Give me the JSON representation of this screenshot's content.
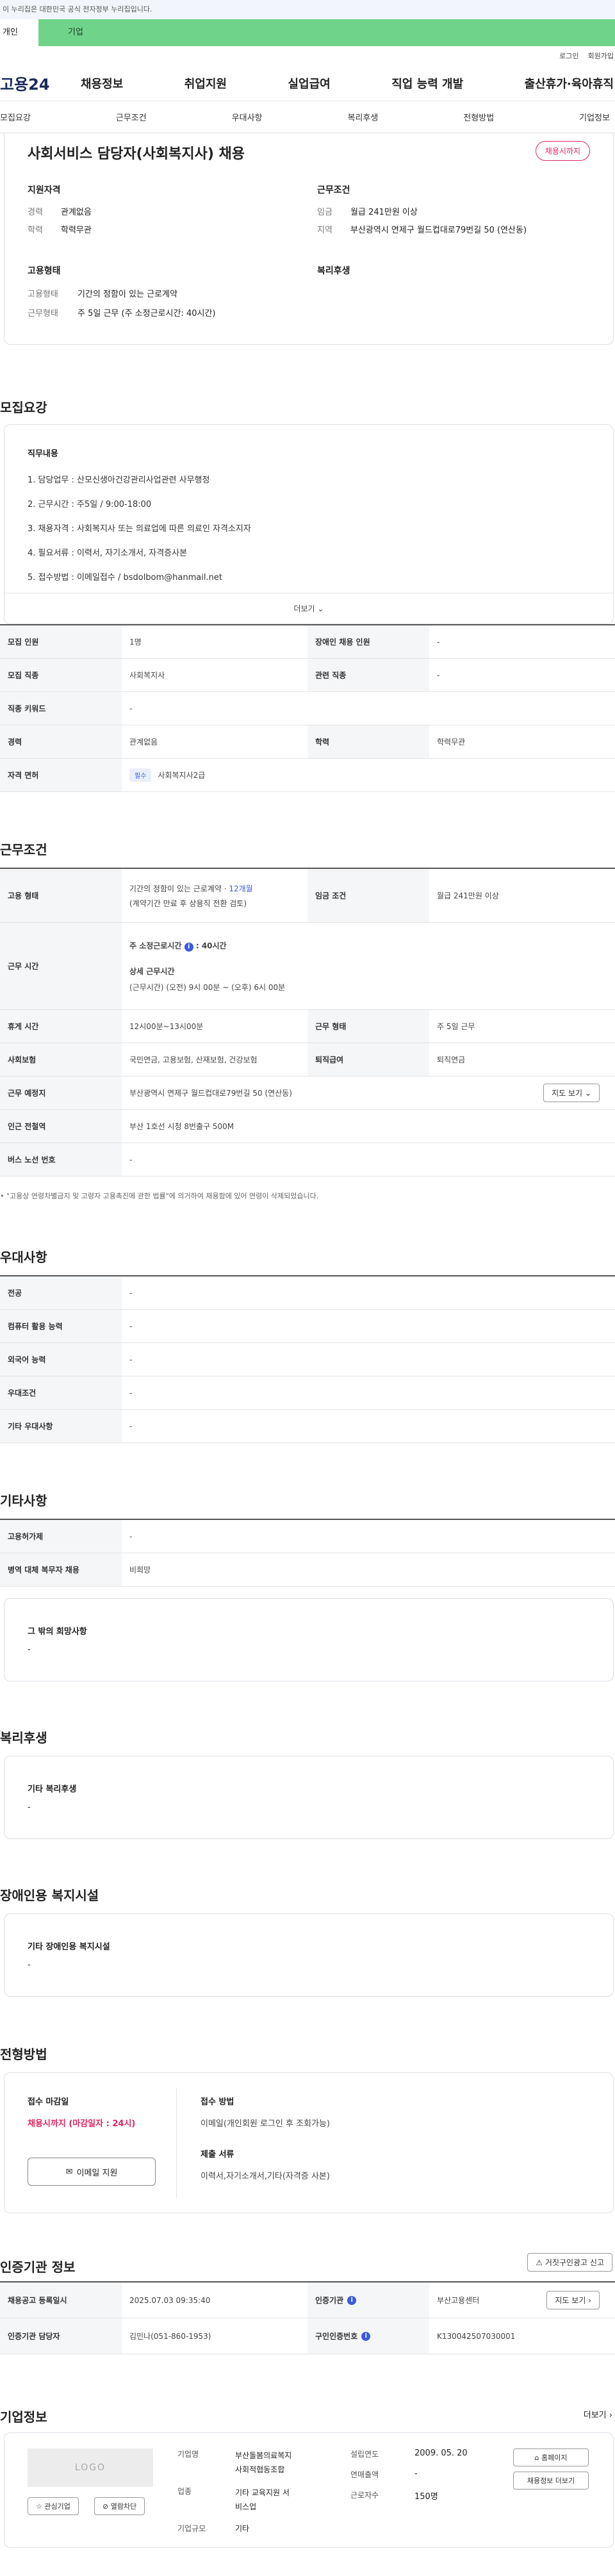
{
  "gov_banner": "이 누리집은 대한민국 공식 전자정부 누리집입니다.",
  "top_tabs": [
    "개인",
    "기업"
  ],
  "util_links": [
    "로그인",
    "회원가입"
  ],
  "gnb": {
    "logo": "고용24",
    "menu": [
      "채용정보",
      "취업지원",
      "실업급여",
      "직업 능력 개발",
      "출산휴가·육아휴직"
    ]
  },
  "snb": [
    "모집요강",
    "근무조건",
    "우대사항",
    "복리후생",
    "전형방법",
    "기업정보"
  ],
  "summary": {
    "title": "사회서비스 담당자(사회복지사) 채용",
    "badge": "채용시까지",
    "qual_head": "지원자격",
    "qual": [
      {
        "k": "경력",
        "v": "관계없음"
      },
      {
        "k": "학력",
        "v": "학력무관"
      }
    ],
    "cond_head": "근무조건",
    "cond": [
      {
        "k": "임금",
        "v": "월급 241만원 이상"
      },
      {
        "k": "지역",
        "v": "부산광역시 연제구 월드컵대로79번길 50 (연산동)"
      }
    ],
    "emp_head": "고용형태",
    "emp": [
      {
        "k": "고용형태",
        "v": "기간의 정함이 있는 근로계약"
      },
      {
        "k": "근무형태",
        "v": "주 5일 근무 (주 소정근로시간: 40시간)"
      }
    ],
    "welfare_head": "복리후생"
  },
  "recruit": {
    "heading": "모집요강",
    "duty_head": "직무내용",
    "duties": [
      "1. 담당업무 : 산모신생아건강관리사업관련 사무행정",
      "2. 근무시간 : 주5일 / 9:00-18:00",
      "3. 채용자격 : 사회복지사 또는 의료업에 따른 의료인 자격소지자",
      "4. 필요서류 : 이력서, 자기소개서, 자격증사본",
      "5. 접수방법 : 이메일접수 / bsdolbom@hanmail.net"
    ],
    "more": "더보기",
    "rows": [
      [
        {
          "k": "모집 인원",
          "v": "1명"
        },
        {
          "k": "장애인 채용 인원",
          "v": "-"
        }
      ],
      [
        {
          "k": "모집 직종",
          "v": "사회복지사"
        },
        {
          "k": "관련 직종",
          "v": "-"
        }
      ],
      [
        {
          "k": "직종 키워드",
          "v": "-"
        }
      ],
      [
        {
          "k": "경력",
          "v": "관계없음"
        },
        {
          "k": "학력",
          "v": "학력무관"
        }
      ]
    ],
    "license_k": "자격 면허",
    "license_pill": "필수",
    "license_v": "사회복지사2급"
  },
  "work": {
    "heading": "근무조건",
    "type_k": "고용 형태",
    "type_v1": "기간의 정함이 있는 근로계약 · ",
    "type_v1b": "12개월",
    "type_v2": "(계약기간 만료 후 상용직 전환 검토)",
    "wage_k": "임금 조건",
    "wage_v": "월급 241만원 이상",
    "hours_k": "근무 시간",
    "hours_a": "주 소정근로시간",
    "hours_b": ": 40시간",
    "hours_c": "상세 근무시간",
    "hours_d": "(근무시간) (오전) 9시 00분 ~ (오후) 6시 00분",
    "rows": [
      [
        {
          "k": "휴게 시간",
          "v": "12시00분~13시00분"
        },
        {
          "k": "근무 형태",
          "v": "주 5일 근무"
        }
      ],
      [
        {
          "k": "사회보험",
          "v": "국민연금, 고용보험, 산재보험, 건강보험"
        },
        {
          "k": "퇴직급여",
          "v": "퇴직연금"
        }
      ]
    ],
    "place_k": "근무 예정지",
    "place_v": "부산광역시 연제구 월드컵대로79번길 50 (연산동)",
    "map_btn": "지도 보기",
    "station_k": "인근 전철역",
    "station_v": "부산 1호선 시청 8번출구 500M",
    "bus_k": "버스 노선 번호",
    "bus_v": "-",
    "note": "\"고용상 연령차별금지 및 고령자 고용촉진에 관한 법률\"에 의거하여 채용함에 있어 연령이 삭제되었습니다."
  },
  "pref": {
    "heading": "우대사항",
    "rows": [
      {
        "k": "전공",
        "v": "-"
      },
      {
        "k": "컴퓨터 활용 능력",
        "v": "-"
      },
      {
        "k": "외국어 능력",
        "v": "-"
      },
      {
        "k": "우대조건",
        "v": "-"
      },
      {
        "k": "기타 우대사항",
        "v": "-"
      }
    ]
  },
  "etc": {
    "heading": "기타사항",
    "rows": [
      {
        "k": "고용허가제",
        "v": "-"
      },
      {
        "k": "병역 대체 복무자 채용",
        "v": "비희망"
      }
    ],
    "box_head": "그 밖의 희망사항",
    "box_v": "-"
  },
  "welfare": {
    "heading": "복리후생",
    "box_head": "기타 복리후생",
    "box_v": "-"
  },
  "disab": {
    "heading": "장애인용 복지시설",
    "box_head": "기타 장애인용 복지시설",
    "box_v": "-"
  },
  "screen": {
    "heading": "전형방법",
    "deadline_head": "접수 마감일",
    "deadline": "채용시까지 (마감일자 : 24시)",
    "email_btn": "이메일 지원",
    "method_head": "접수 방법",
    "method_v": "이메일(개인회원 로그인 후 조회가능)",
    "docs_head": "제출 서류",
    "docs_v": "이력서,자기소개서,기타(자격증 사본)"
  },
  "agency": {
    "heading": "인증기관 정보",
    "report_btn": "거짓구인광고 신고",
    "row1": [
      {
        "k": "채용공고 등록일시",
        "v": "2025.07.03 09:35:40"
      },
      {
        "k": "인증기관",
        "v": "부산고용센터"
      }
    ],
    "map_btn": "지도 보기",
    "row2": [
      {
        "k": "인증기관 담당자",
        "v": "김민나(051-860-1953)"
      },
      {
        "k": "구인인증번호",
        "v": "K130042507030001"
      }
    ]
  },
  "company": {
    "heading": "기업정보",
    "more": "더보기",
    "logo": "LOGO",
    "fav_btn": "관심기업",
    "block_btn": "열람차단",
    "fields": {
      "k1": "기업명",
      "v1a": "부산돌봄의료복지",
      "v1b": "사회적협동조합",
      "k2": "업종",
      "v2a": "기타 교육지원 서",
      "v2b": "비스업",
      "k3": "기업규모",
      "v3": "기타",
      "k4": "설립연도",
      "v4": "2009. 05. 20",
      "k5": "연매출액",
      "v5": "-",
      "k6": "근로자수",
      "v6": "150명"
    },
    "home_btn": "홈페이지",
    "list_btn": "채용정보 더보기"
  },
  "colors": {
    "accent": "#3b5bdb",
    "alert": "#e0245e",
    "green_tab": "#6fd48a"
  }
}
